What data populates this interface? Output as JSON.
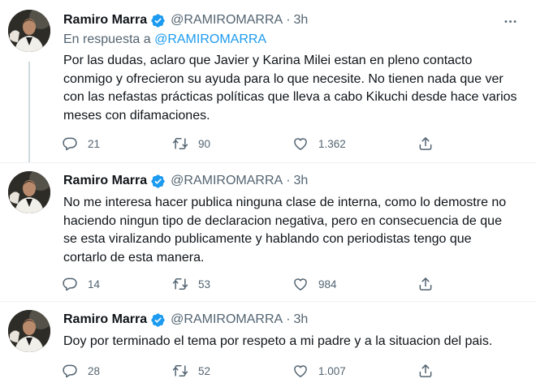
{
  "tweets": [
    {
      "author": "Ramiro Marra",
      "handle": "@RAMIROMARRA",
      "separator": "·",
      "time": "3h",
      "reply_prefix": "En respuesta a",
      "reply_mention": "@RAMIROMARRA",
      "text": "Por las dudas, aclaro que Javier y Karina Milei estan en pleno contacto conmigo y ofrecieron su ayuda para lo que necesite. No tienen nada que ver con las nefastas prácticas políticas que lleva a cabo Kikuchi desde hace varios meses con difamaciones.",
      "replies": "21",
      "retweets": "90",
      "likes": "1.362"
    },
    {
      "author": "Ramiro Marra",
      "handle": "@RAMIROMARRA",
      "separator": "·",
      "time": "3h",
      "text": "No me interesa hacer publica ninguna clase de interna, como lo demostre no haciendo ningun tipo de declaracion negativa, pero en consecuencia de que se esta viralizando publicamente y hablando con periodistas tengo que cortarlo de esta manera.",
      "replies": "14",
      "retweets": "53",
      "likes": "984"
    },
    {
      "author": "Ramiro Marra",
      "handle": "@RAMIROMARRA",
      "separator": "·",
      "time": "3h",
      "text": "Doy por terminado el tema por respeto a mi padre y a la situacion del pais.",
      "replies": "28",
      "retweets": "52",
      "likes": "1.007"
    }
  ],
  "icons": {
    "verified": "verified-badge-icon",
    "more": "more-dots-icon",
    "reply": "reply-bubble-icon",
    "retweet": "retweet-icon",
    "like": "heart-icon",
    "share": "share-upload-icon"
  },
  "colors": {
    "accent": "#1d9bf0",
    "secondary_text": "#536471",
    "primary_text": "#0f1419",
    "divider": "#eff3f4"
  }
}
